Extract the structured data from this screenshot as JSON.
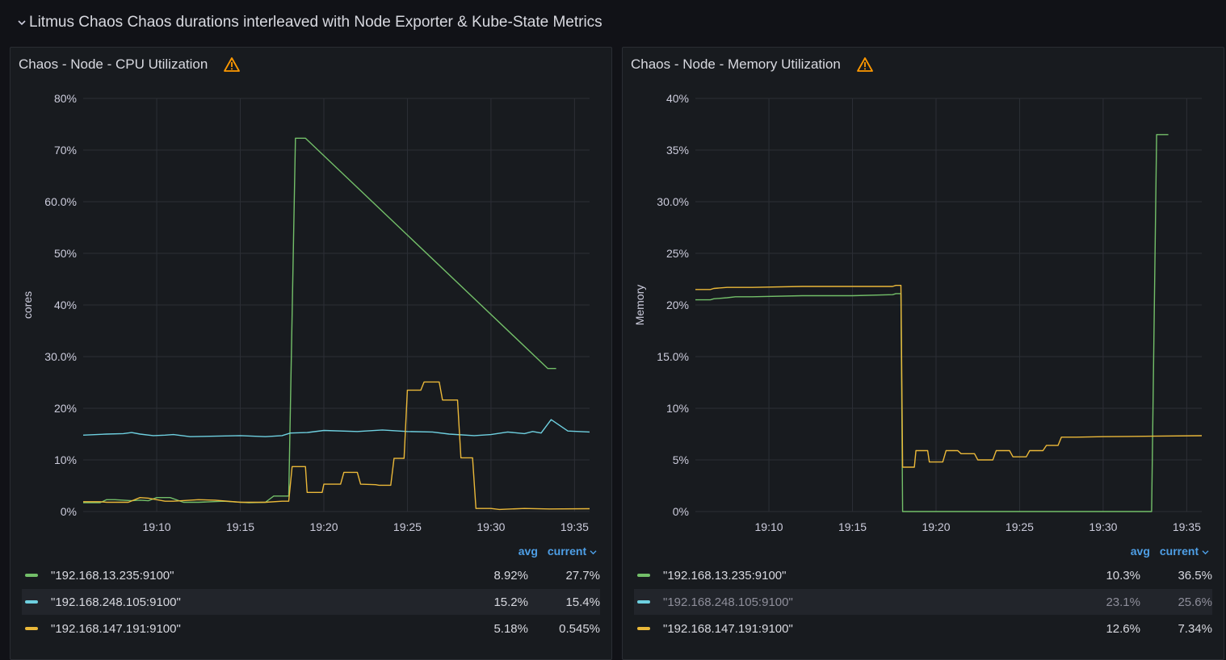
{
  "row": {
    "title": "Litmus Chaos Chaos durations interleaved with Node Exporter & Kube-State Metrics"
  },
  "colors": {
    "green": "#73bf69",
    "cyan": "#6ed0e0",
    "yellow": "#eab839",
    "accent": "#4e9fe6",
    "warning": "#ff9900"
  },
  "panels": [
    {
      "title": "Chaos - Node - CPU Utilization",
      "legend": {
        "avg_label": "avg",
        "current_label": "current",
        "items": [
          {
            "name": "\"192.168.13.235:9100\"",
            "avg": "8.92%",
            "current": "27.7%"
          },
          {
            "name": "\"192.168.248.105:9100\"",
            "avg": "15.2%",
            "current": "15.4%"
          },
          {
            "name": "\"192.168.147.191:9100\"",
            "avg": "5.18%",
            "current": "0.545%"
          }
        ]
      }
    },
    {
      "title": "Chaos - Node - Memory Utilization",
      "legend": {
        "avg_label": "avg",
        "current_label": "current",
        "items": [
          {
            "name": "\"192.168.13.235:9100\"",
            "avg": "10.3%",
            "current": "36.5%"
          },
          {
            "name": "\"192.168.248.105:9100\"",
            "avg": "23.1%",
            "current": "25.6%"
          },
          {
            "name": "\"192.168.147.191:9100\"",
            "avg": "12.6%",
            "current": "7.34%"
          }
        ]
      }
    }
  ],
  "chart_data": [
    {
      "type": "line",
      "title": "Chaos - Node - CPU Utilization",
      "ylabel": "cores",
      "y_ticks": [
        "0%",
        "10%",
        "20%",
        "30.0%",
        "40%",
        "50%",
        "60.0%",
        "70%",
        "80%"
      ],
      "ylim": [
        0,
        80
      ],
      "x_ticks": [
        "19:10",
        "19:15",
        "19:20",
        "19:25",
        "19:30",
        "19:35"
      ],
      "xlim": [
        5.6,
        35.9
      ],
      "x_unit": "minutes past 19:00",
      "series": [
        {
          "name": "\"192.168.13.235:9100\"",
          "color": "#73bf69",
          "x": [
            5.6,
            6.6,
            7.0,
            7.5,
            8.0,
            8.5,
            9.0,
            9.5,
            10.0,
            10.8,
            11.6,
            12.5,
            14.0,
            15.5,
            16.5,
            17.0,
            17.9,
            18.3,
            18.9,
            33.4,
            33.9
          ],
          "y": [
            1.7,
            1.7,
            2.3,
            2.3,
            2.2,
            2.1,
            2.2,
            2.1,
            2.7,
            2.7,
            1.8,
            1.8,
            2.0,
            1.7,
            1.8,
            3.0,
            3.0,
            72.3,
            72.3,
            27.7,
            27.7
          ]
        },
        {
          "name": "\"192.168.248.105:9100\"",
          "color": "#6ed0e0",
          "x": [
            5.6,
            7.0,
            8.0,
            8.5,
            9.0,
            9.8,
            10.5,
            11.0,
            12.0,
            13.5,
            15.0,
            16.5,
            17.5,
            18.0,
            19.0,
            20.0,
            22.0,
            23.5,
            25.0,
            26.5,
            27.5,
            29.0,
            30.0,
            31.0,
            32.0,
            32.5,
            33.0,
            33.6,
            34.6,
            35.9
          ],
          "y": [
            14.8,
            15.0,
            15.1,
            15.3,
            15.0,
            14.7,
            14.8,
            14.9,
            14.5,
            14.6,
            14.7,
            14.5,
            14.7,
            15.2,
            15.3,
            15.7,
            15.5,
            15.8,
            15.5,
            15.4,
            15.0,
            14.7,
            14.9,
            15.4,
            15.1,
            15.5,
            15.2,
            17.8,
            15.6,
            15.4
          ]
        },
        {
          "name": "\"192.168.147.191:9100\"",
          "color": "#eab839",
          "x": [
            5.6,
            6.6,
            7.0,
            8.3,
            9.0,
            9.5,
            10.5,
            11.0,
            12.5,
            13.5,
            15.0,
            16.5,
            17.5,
            17.9,
            18.1,
            18.9,
            19.0,
            19.9,
            20.0,
            21.0,
            21.2,
            22.0,
            22.2,
            23.1,
            23.3,
            24.0,
            24.2,
            24.8,
            25.0,
            25.8,
            26.0,
            26.9,
            27.1,
            28.0,
            28.2,
            28.9,
            29.1,
            30.0,
            30.5,
            32.0,
            33.5,
            35.9
          ],
          "y": [
            1.9,
            1.9,
            1.8,
            1.8,
            2.7,
            2.6,
            2.0,
            2.0,
            2.3,
            2.2,
            1.8,
            1.8,
            2.0,
            2.0,
            8.7,
            8.7,
            3.7,
            3.7,
            5.3,
            5.3,
            7.6,
            7.6,
            5.3,
            5.2,
            5.1,
            5.1,
            10.3,
            10.3,
            23.5,
            23.5,
            25.1,
            25.1,
            21.6,
            21.6,
            10.4,
            10.4,
            0.6,
            0.6,
            0.4,
            0.6,
            0.5,
            0.545
          ]
        }
      ]
    },
    {
      "type": "line",
      "title": "Chaos - Node - Memory Utilization",
      "ylabel": "Memory",
      "y_ticks": [
        "0%",
        "5%",
        "10%",
        "15.0%",
        "20%",
        "25%",
        "30.0%",
        "35%",
        "40%"
      ],
      "ylim": [
        0,
        40
      ],
      "x_ticks": [
        "19:10",
        "19:15",
        "19:20",
        "19:25",
        "19:30",
        "19:35"
      ],
      "xlim": [
        5.6,
        35.9
      ],
      "x_unit": "minutes past 19:00",
      "series": [
        {
          "name": "\"192.168.13.235:9100\"",
          "color": "#73bf69",
          "x": [
            5.6,
            6.5,
            6.7,
            7.5,
            8.0,
            9.0,
            12.0,
            15.0,
            17.4,
            17.6,
            17.9,
            18.0,
            20.0,
            25.0,
            30.0,
            32.9,
            33.2,
            33.9
          ],
          "y": [
            20.5,
            20.5,
            20.6,
            20.7,
            20.8,
            20.8,
            20.9,
            20.9,
            21.0,
            21.1,
            21.1,
            0.0,
            0.0,
            0.0,
            0.0,
            0.0,
            36.5,
            36.5
          ]
        },
        {
          "name": "\"192.168.147.191:9100\"",
          "color": "#eab839",
          "x": [
            5.6,
            6.5,
            6.7,
            7.5,
            8.0,
            9.0,
            12.0,
            15.0,
            17.4,
            17.6,
            17.9,
            18.0,
            18.7,
            18.8,
            19.5,
            19.6,
            20.4,
            20.6,
            21.3,
            21.5,
            22.3,
            22.5,
            23.4,
            23.6,
            24.4,
            24.6,
            25.4,
            25.6,
            26.4,
            26.6,
            27.3,
            27.5,
            28.2,
            28.4,
            30.0,
            33.0,
            35.9
          ],
          "y": [
            21.5,
            21.5,
            21.6,
            21.7,
            21.7,
            21.7,
            21.8,
            21.8,
            21.8,
            21.9,
            21.9,
            4.3,
            4.3,
            5.9,
            5.9,
            4.8,
            4.8,
            5.9,
            5.9,
            5.6,
            5.6,
            5.0,
            5.0,
            5.9,
            5.9,
            5.3,
            5.3,
            5.9,
            5.9,
            6.4,
            6.4,
            7.2,
            7.2,
            7.2,
            7.25,
            7.3,
            7.34
          ]
        }
      ]
    }
  ]
}
